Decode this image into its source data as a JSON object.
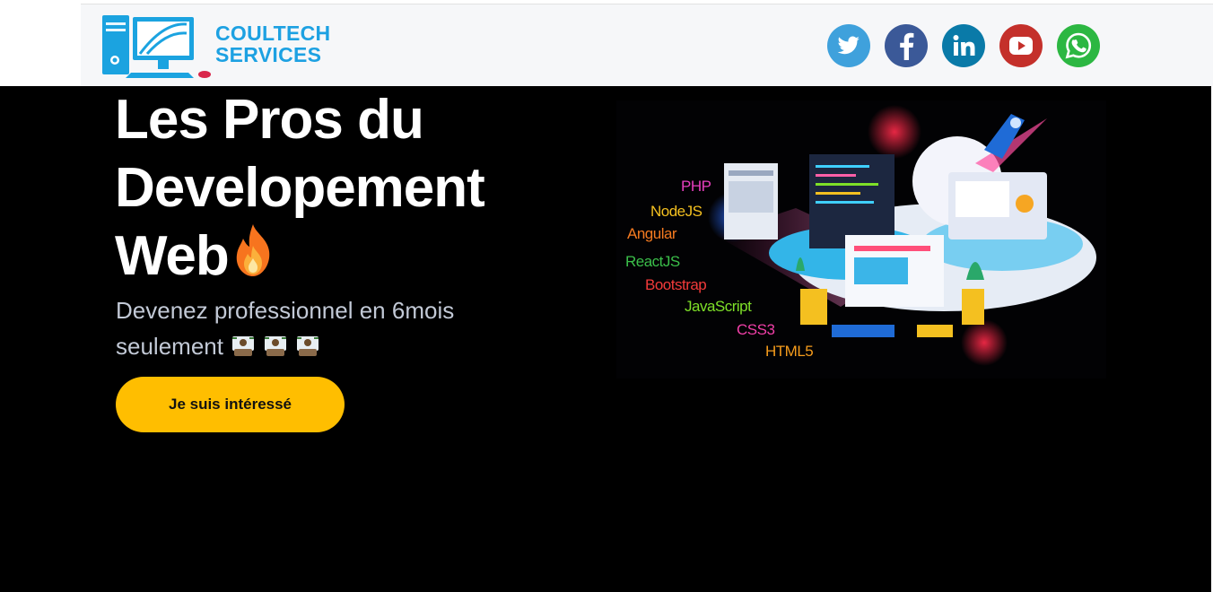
{
  "header": {
    "logo_line1": "COULTECH",
    "logo_line2": "SERVICES",
    "socials": [
      {
        "name": "twitter-icon",
        "color": "#3fa1dc"
      },
      {
        "name": "facebook-icon",
        "color": "#3b5998"
      },
      {
        "name": "linkedin-icon",
        "color": "#0a7aa8"
      },
      {
        "name": "youtube-icon",
        "color": "#c4302b"
      },
      {
        "name": "whatsapp-icon",
        "color": "#2cb742"
      }
    ]
  },
  "hero": {
    "title_line1": "Les Pros du",
    "title_line2": "Developement",
    "title_line3": "Web",
    "subtitle_line1": "Devenez professionnel en 6mois",
    "subtitle_line2": "seulement",
    "cta_label": "Je suis intéressé",
    "cta_color": "#ffbe00"
  },
  "illustration": {
    "technologies": [
      {
        "label": "PHP",
        "color": "#e83fbf"
      },
      {
        "label": "NodeJS",
        "color": "#f4c020"
      },
      {
        "label": "Angular",
        "color": "#f47a20"
      },
      {
        "label": "ReactJS",
        "color": "#3bbf4a"
      },
      {
        "label": "Bootstrap",
        "color": "#f23a3a"
      },
      {
        "label": "JavaScript",
        "color": "#7ee028"
      },
      {
        "label": "CSS3",
        "color": "#f03fa8"
      },
      {
        "label": "HTML5",
        "color": "#f59c1c"
      }
    ]
  }
}
